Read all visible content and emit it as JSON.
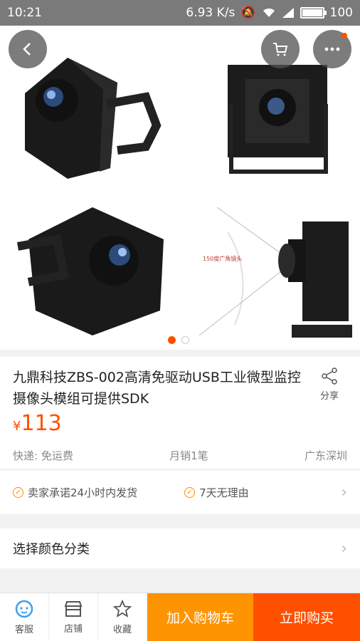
{
  "status_bar": {
    "time": "10:21",
    "net_speed": "6.93 K/s",
    "battery": "100"
  },
  "gallery": {
    "annotation": "150度广角镜头",
    "page_count": 2,
    "active_page": 1
  },
  "product": {
    "title": "九鼎科技ZBS-002高清免驱动USB工业微型监控摄像头模组可提供SDK",
    "share_label": "分享",
    "currency": "¥",
    "price": "113",
    "shipping": "快递: 免运费",
    "monthly_sales": "月销1笔",
    "location": "广东深圳"
  },
  "promises": {
    "item1": "卖家承诺24小时内发货",
    "item2": "7天无理由"
  },
  "sku": {
    "label": "选择颜色分类"
  },
  "bottom_bar": {
    "service": "客服",
    "shop": "店铺",
    "favorite": "收藏",
    "add_to_cart": "加入购物车",
    "buy_now": "立即购买"
  },
  "colors": {
    "accent": "#ff5000",
    "cart": "#ff9402"
  }
}
